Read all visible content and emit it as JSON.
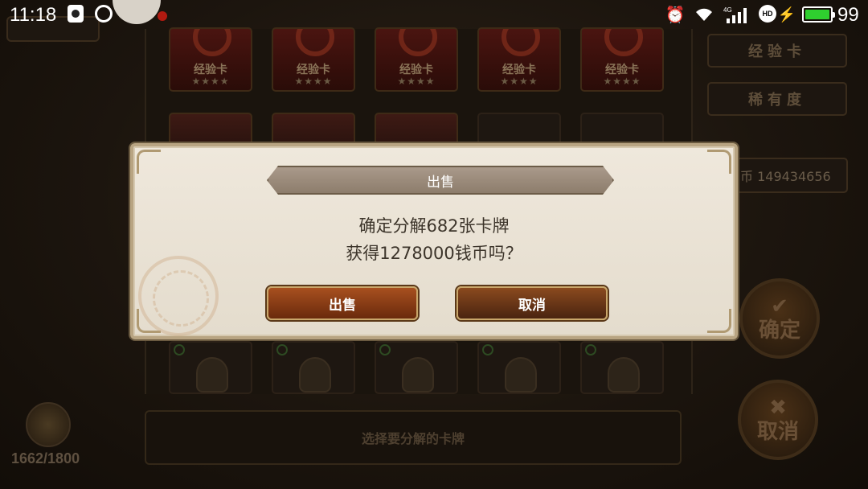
{
  "status_bar": {
    "time": "11:18",
    "network_label": "4G",
    "battery_percent": 99,
    "battery_level": 0.99,
    "battery_color": "#2fcf2f"
  },
  "scene": {
    "cards_top_row": [
      {
        "name": "经验卡",
        "stars": "★★★★"
      },
      {
        "name": "经验卡",
        "stars": "★★★★"
      },
      {
        "name": "经验卡",
        "stars": "★★★★"
      },
      {
        "name": "经验卡",
        "stars": "★★★★"
      },
      {
        "name": "经验卡",
        "stars": "★★★★"
      }
    ],
    "filter_buttons": [
      "经验卡",
      "稀有度"
    ],
    "coins_label": "币 149434656",
    "confirm_button": "确定",
    "cancel_button": "取消",
    "hint_text": "选择要分解的卡牌",
    "bag_count": "1662/1800"
  },
  "dialog": {
    "title": "出售",
    "message_line1": "确定分解682张卡牌",
    "message_line2": "获得1278000钱币吗？",
    "sell_button": "出售",
    "cancel_button": "取消"
  },
  "colors": {
    "dialog_bg": "#ece5d8",
    "sell_button": "#a7501f",
    "cancel_button": "#8a4a1e",
    "title_bar": "#9d8d7c"
  }
}
